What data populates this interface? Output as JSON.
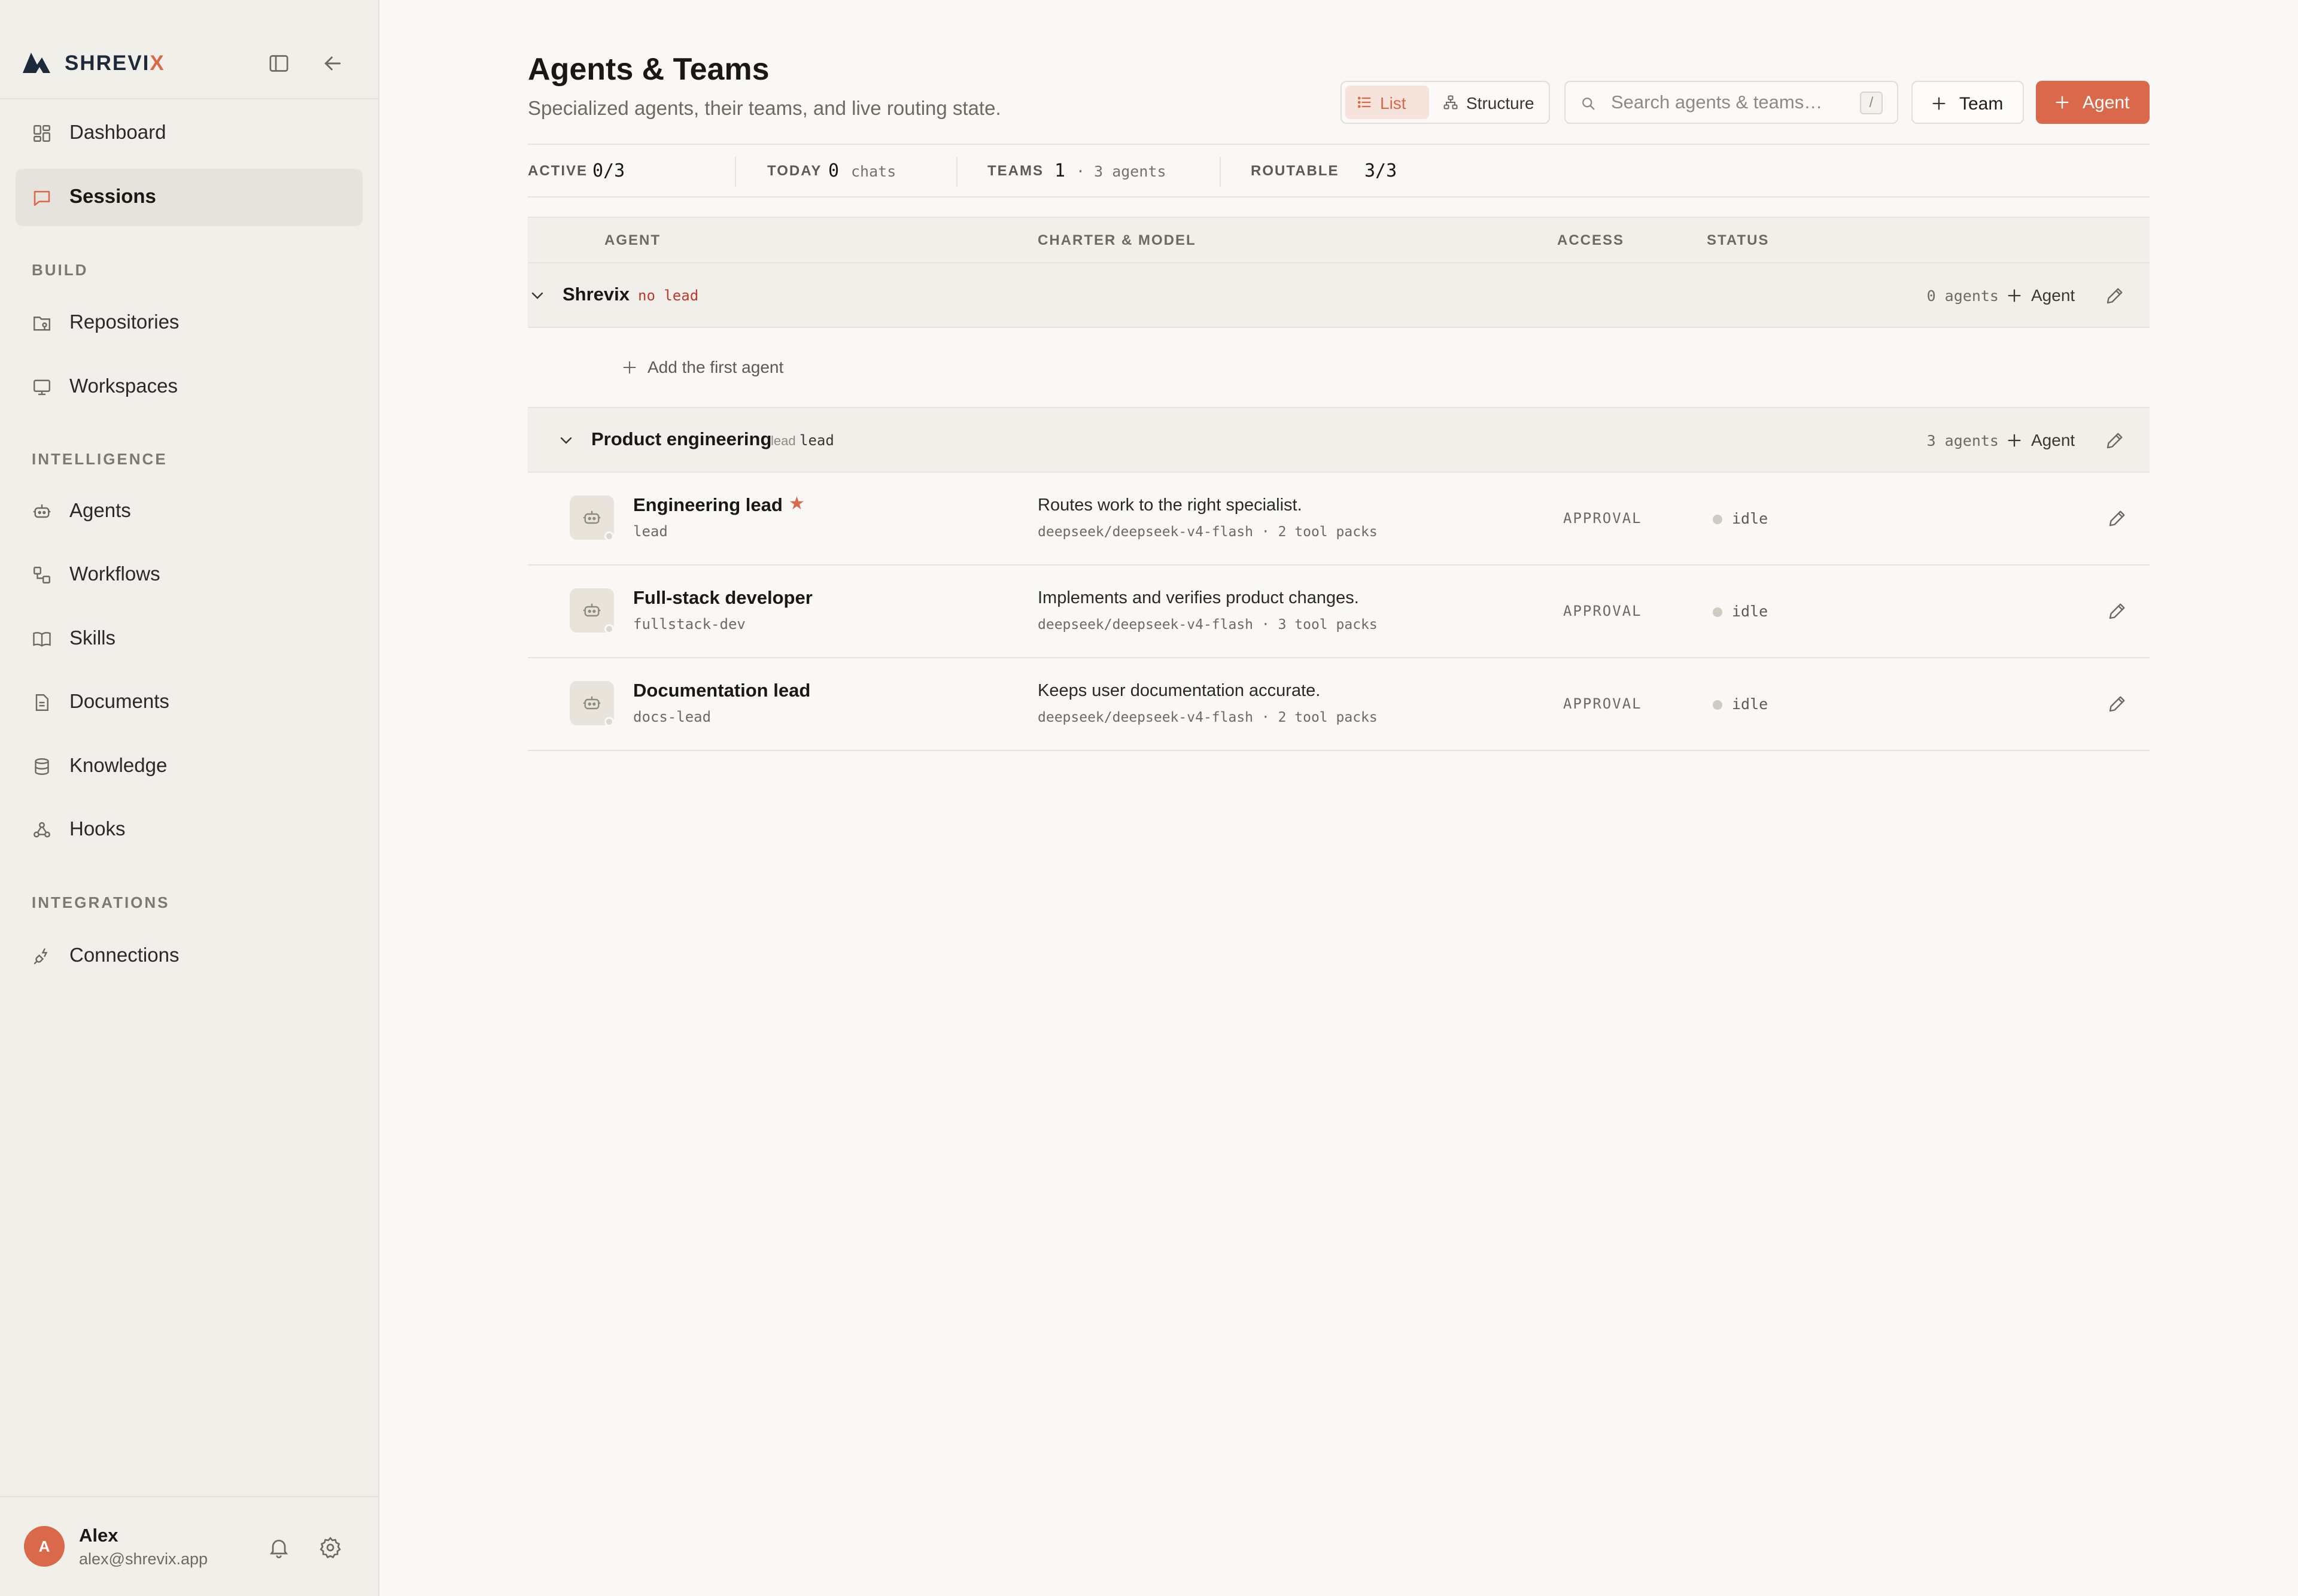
{
  "app": {
    "name_main": "SHREVI",
    "name_accent": "X"
  },
  "sidebar": {
    "primary": [
      {
        "label": "Dashboard",
        "icon": "dashboard-icon"
      },
      {
        "label": "Sessions",
        "icon": "chat-icon",
        "active": true
      }
    ],
    "sections": [
      {
        "title": "BUILD",
        "items": [
          {
            "label": "Repositories",
            "icon": "repo-icon"
          },
          {
            "label": "Workspaces",
            "icon": "monitor-icon"
          }
        ]
      },
      {
        "title": "INTELLIGENCE",
        "items": [
          {
            "label": "Agents",
            "icon": "bot-icon"
          },
          {
            "label": "Workflows",
            "icon": "workflow-icon"
          },
          {
            "label": "Skills",
            "icon": "book-icon"
          },
          {
            "label": "Documents",
            "icon": "document-icon"
          },
          {
            "label": "Knowledge",
            "icon": "database-icon"
          },
          {
            "label": "Hooks",
            "icon": "webhook-icon"
          }
        ]
      },
      {
        "title": "INTEGRATIONS",
        "items": [
          {
            "label": "Connections",
            "icon": "plug-icon"
          }
        ]
      }
    ],
    "user": {
      "initial": "A",
      "name": "Alex",
      "email": "alex@shrevix.app"
    }
  },
  "header": {
    "title": "Agents & Teams",
    "subtitle": "Specialized agents, their teams, and live routing state.",
    "view_list": "List",
    "view_structure": "Structure",
    "search_placeholder": "Search agents & teams…",
    "search_shortcut": "/",
    "add_team": "Team",
    "add_agent": "Agent"
  },
  "stats": {
    "active_label": "ACTIVE",
    "active_value": "0/3",
    "today_label": "TODAY",
    "today_value": "0",
    "today_unit": "chats",
    "teams_label": "TEAMS",
    "teams_value": "1",
    "teams_unit": "· 3 agents",
    "routable_label": "ROUTABLE",
    "routable_value": "3/3"
  },
  "table": {
    "columns": {
      "agent": "AGENT",
      "charter": "CHARTER & MODEL",
      "access": "ACCESS",
      "status": "STATUS"
    },
    "teams": [
      {
        "name": "Shrevix",
        "lead_tag": "no lead",
        "count": "0 agents",
        "add_label": "Agent",
        "empty_label": "Add the first agent"
      },
      {
        "name": "Product engineering",
        "lead_prefix": "lead",
        "lead_value": "lead",
        "count": "3 agents",
        "add_label": "Agent",
        "agents": [
          {
            "name": "Engineering lead",
            "slug": "lead",
            "is_lead": true,
            "star": "★",
            "charter": "Routes work to the right specialist.",
            "model": "deepseek/deepseek-v4-flash · 2 tool packs",
            "access": "APPROVAL",
            "status": "idle"
          },
          {
            "name": "Full-stack developer",
            "slug": "fullstack-dev",
            "charter": "Implements and verifies product changes.",
            "model": "deepseek/deepseek-v4-flash · 3 tool packs",
            "access": "APPROVAL",
            "status": "idle"
          },
          {
            "name": "Documentation lead",
            "slug": "docs-lead",
            "charter": "Keeps user documentation accurate.",
            "model": "deepseek/deepseek-v4-flash · 2 tool packs",
            "access": "APPROVAL",
            "status": "idle"
          }
        ]
      }
    ]
  },
  "colors": {
    "accent": "#d9694a",
    "sidebar_bg": "#f1efea",
    "page_bg": "#f9f8f5"
  }
}
